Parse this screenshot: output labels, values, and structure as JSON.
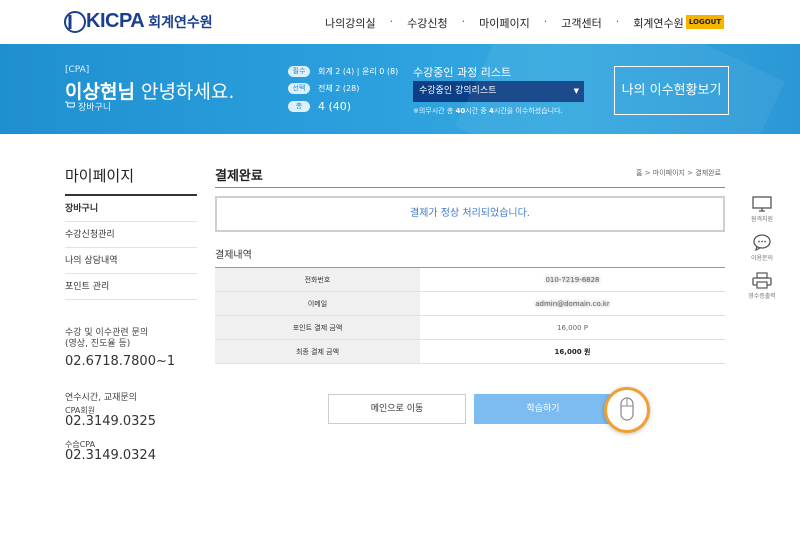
{
  "header": {
    "logo_text": "KICPA",
    "logo_sub": "회계연수원",
    "nav": [
      "나의강의실",
      "수강신청",
      "마이페이지",
      "고객센터",
      "회계연수원"
    ],
    "logout": "LOGOUT"
  },
  "banner": {
    "tag": "[CPA]",
    "user_name": "이상현님",
    "greeting": "안녕하세요.",
    "cart": "장바구니",
    "stats": [
      {
        "badge": "필수",
        "text": "회계 2 (4) | 윤리 0 (8)"
      },
      {
        "badge": "선택",
        "text": "전체 2 (28)"
      },
      {
        "badge": "총",
        "text": "4 (40)"
      }
    ],
    "course_title": "수강중인 과정 리스트",
    "course_select": "수강중인 강의리스트",
    "note_prefix": "※의무시간 총 ",
    "note_total": "40",
    "note_mid": "시간 중 ",
    "note_done": "4",
    "note_suffix": "시간을 이수하셨습니다.",
    "status_button": "나의 이수현황보기"
  },
  "sidebar": {
    "title": "마이페이지",
    "items": [
      "장바구니",
      "수강신청관리",
      "나의 상담내역",
      "포인트 관리"
    ],
    "contact1_label": "수강 및 이수관련 문의",
    "contact1_sub": "(영상, 진도율 등)",
    "contact1_phone": "02.6718.7800~1",
    "contact2_label": "연수시간, 교재문의",
    "contact2_sub": "CPA회원",
    "contact2_phone": "02.3149.0325",
    "contact3_sub": "수습CPA",
    "contact3_phone": "02.3149.0324"
  },
  "main": {
    "title": "결제완료",
    "breadcrumb": "홈 > 마이페이지 > 결제완료",
    "notice": "결제가 정상 처리되었습니다.",
    "section": "결제내역",
    "rows": [
      {
        "label": "전화번호",
        "value": "010-7219-6828",
        "blur": true
      },
      {
        "label": "이메일",
        "value": "admin@domain.co.kr",
        "blur": true
      },
      {
        "label": "포인트 결제 금액",
        "value": "16,000 P",
        "blur": false
      },
      {
        "label": "최종 결제 금액",
        "value": "16,000 원",
        "blur": false,
        "bold": true
      }
    ],
    "btn_main": "메인으로 이동",
    "btn_study": "학습하기"
  },
  "quick": [
    "원격지원",
    "이용문의",
    "영수증출력"
  ],
  "colors": {
    "brand": "#1b3f8f",
    "banner": "#2a9edc",
    "accent": "#f4b400",
    "study_button": "#7cbcf0",
    "cursor_ring": "#f0a033"
  },
  "icons": [
    "kicpa-logo-icon",
    "cart-icon",
    "chevron-down-icon",
    "monitor-icon",
    "chat-icon",
    "printer-icon",
    "mouse-cursor-icon"
  ]
}
